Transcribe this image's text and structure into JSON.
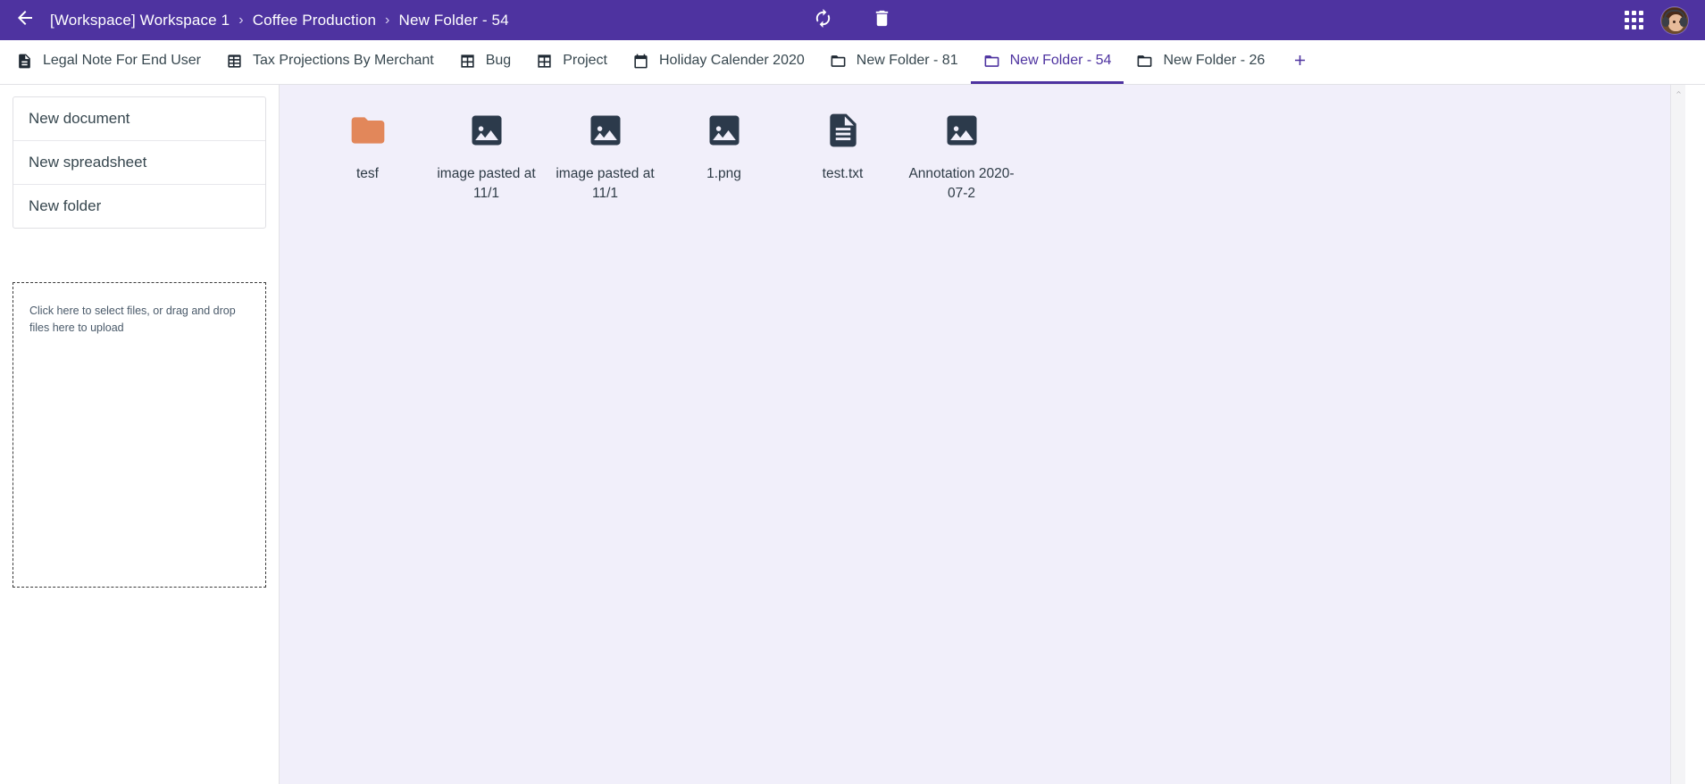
{
  "theme": {
    "header_purple": "#4e33a0",
    "accent_purple": "#4e33a0",
    "main_background": "#f1effa",
    "sidebar_background": "#ffffff",
    "folder_orange": "#e2875a",
    "file_icon_navy": "#2c3a4b"
  },
  "header": {
    "back_label": "Back",
    "breadcrumb": [
      {
        "label": "[Workspace] Workspace 1"
      },
      {
        "label": "Coffee Production"
      },
      {
        "label": "New Folder - 54"
      }
    ],
    "separator": "›",
    "tools": [
      {
        "name": "refresh-icon",
        "label": "Refresh"
      },
      {
        "name": "trash-icon",
        "label": "Trash"
      }
    ],
    "apps_label": "Apps",
    "avatar_label": "Account"
  },
  "tabs": [
    {
      "label": "Legal Note For End User",
      "icon": "document-icon",
      "active": false
    },
    {
      "label": "Tax Projections By Merchant",
      "icon": "spreadsheet-icon",
      "active": false
    },
    {
      "label": "Bug",
      "icon": "table-icon",
      "active": false
    },
    {
      "label": "Project",
      "icon": "table-icon",
      "active": false
    },
    {
      "label": "Holiday Calender 2020",
      "icon": "calendar-icon",
      "active": false
    },
    {
      "label": "New Folder - 81",
      "icon": "folder-icon",
      "active": false
    },
    {
      "label": "New Folder - 54",
      "icon": "folder-icon",
      "active": true
    },
    {
      "label": "New Folder - 26",
      "icon": "folder-icon",
      "active": false
    }
  ],
  "add_tab_label": "+",
  "sidebar": {
    "create_menu": [
      {
        "label": "New document"
      },
      {
        "label": "New spreadsheet"
      },
      {
        "label": "New folder"
      }
    ],
    "upload": {
      "text": "Click here to select files, or drag and drop files here to upload"
    }
  },
  "main": {
    "files": [
      {
        "name": "tesf",
        "type": "folder"
      },
      {
        "name": "image pasted at 11/1",
        "type": "image"
      },
      {
        "name": "image pasted at 11/1",
        "type": "image"
      },
      {
        "name": "1.png",
        "type": "image"
      },
      {
        "name": "test.txt",
        "type": "text"
      },
      {
        "name": "Annotation 2020-07-2",
        "type": "image"
      }
    ]
  }
}
